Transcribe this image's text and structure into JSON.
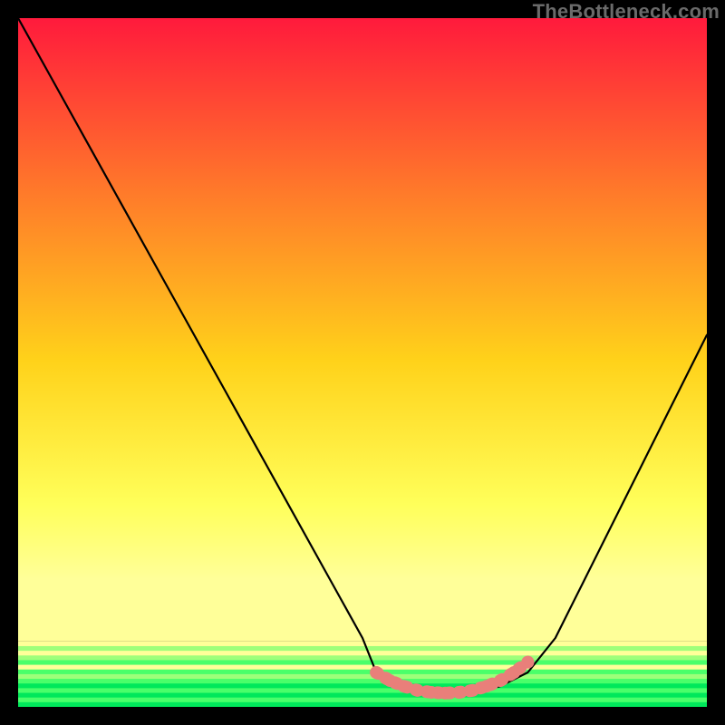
{
  "watermark": "TheBottleneck.com",
  "colors": {
    "top": "#ff1a3c",
    "mid1": "#ff7a2a",
    "mid2": "#ffd21a",
    "mid3": "#ffff5a",
    "bottom_yellow": "#ffff99",
    "green_light": "#9eff7a",
    "green_mid": "#4aff6a",
    "green_deep": "#00e85b",
    "curve": "#000000",
    "marker": "#e97f7a"
  },
  "chart_data": {
    "type": "line",
    "title": "",
    "xlabel": "",
    "ylabel": "",
    "xlim": [
      0,
      100
    ],
    "ylim": [
      0,
      100
    ],
    "series": [
      {
        "name": "bottleneck-curve",
        "x": [
          0,
          5,
          10,
          15,
          20,
          25,
          30,
          35,
          40,
          45,
          50,
          52,
          55,
          58,
          62,
          66,
          70,
          74,
          78,
          82,
          86,
          90,
          94,
          98,
          100
        ],
        "y": [
          100,
          91,
          82,
          73,
          64,
          55,
          46,
          37,
          28,
          19,
          10,
          5,
          3,
          2,
          2,
          2,
          3,
          5,
          10,
          18,
          26,
          34,
          42,
          50,
          54
        ]
      }
    ],
    "markers": {
      "name": "highlight-band",
      "x": [
        52,
        54,
        56,
        58,
        60,
        62,
        64,
        66,
        68,
        70,
        72,
        74
      ],
      "y": [
        5,
        3.8,
        3,
        2.4,
        2.1,
        2,
        2.1,
        2.4,
        3,
        3.8,
        5,
        6.5
      ]
    }
  }
}
